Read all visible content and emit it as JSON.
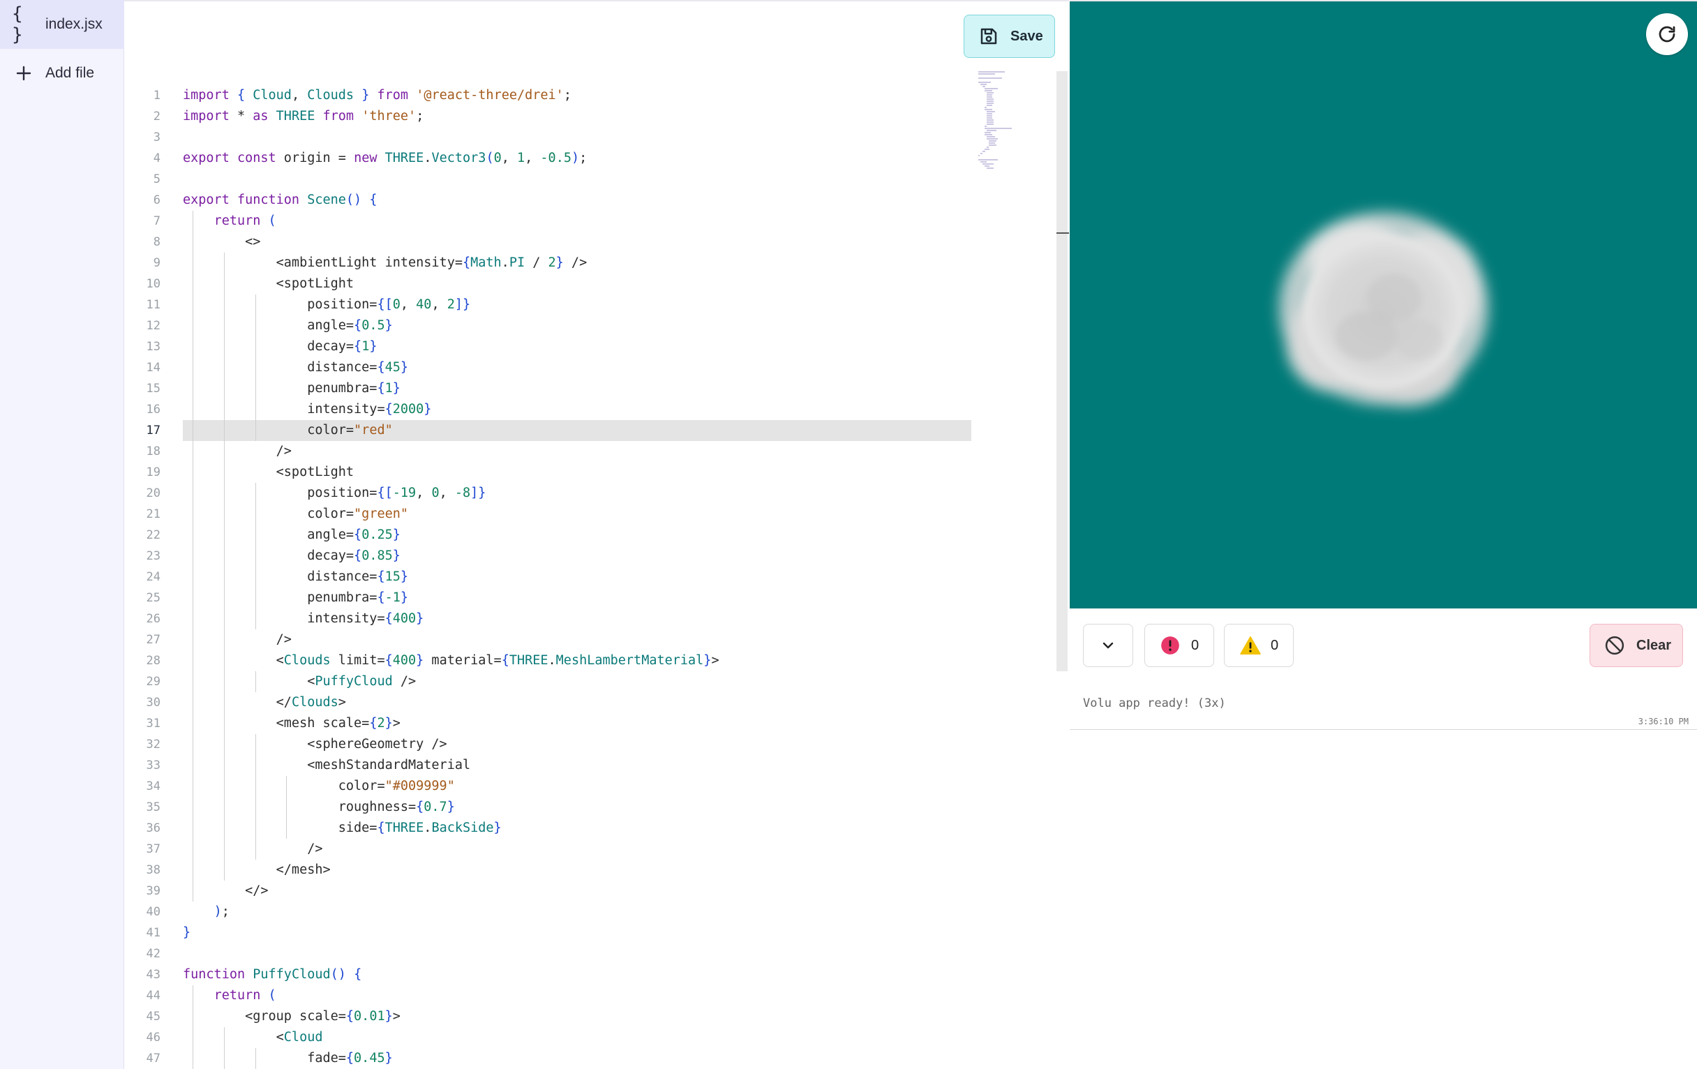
{
  "sidebar": {
    "items": [
      {
        "label": "index.jsx",
        "icon": "braces-icon",
        "glyph": "{ }"
      },
      {
        "label": "Add file",
        "icon": "plus-icon"
      }
    ]
  },
  "toolbar": {
    "save_label": "Save"
  },
  "editor": {
    "current_line": 17,
    "lines": [
      [
        [
          "k",
          "import"
        ],
        [
          "p",
          " "
        ],
        [
          "b",
          "{"
        ],
        [
          "p",
          " "
        ],
        [
          "c",
          "Cloud"
        ],
        [
          "p",
          ", "
        ],
        [
          "c",
          "Clouds"
        ],
        [
          "p",
          " "
        ],
        [
          "b",
          "}"
        ],
        [
          "p",
          " "
        ],
        [
          "k",
          "from"
        ],
        [
          "p",
          " "
        ],
        [
          "s",
          "'@react-three/drei'"
        ],
        [
          "p",
          ";"
        ]
      ],
      [
        [
          "k",
          "import"
        ],
        [
          "p",
          " * "
        ],
        [
          "k",
          "as"
        ],
        [
          "p",
          " "
        ],
        [
          "c",
          "THREE"
        ],
        [
          "p",
          " "
        ],
        [
          "k",
          "from"
        ],
        [
          "p",
          " "
        ],
        [
          "s",
          "'three'"
        ],
        [
          "p",
          ";"
        ]
      ],
      [],
      [
        [
          "k",
          "export"
        ],
        [
          "p",
          " "
        ],
        [
          "k",
          "const"
        ],
        [
          "p",
          " origin = "
        ],
        [
          "k",
          "new"
        ],
        [
          "p",
          " "
        ],
        [
          "c",
          "THREE"
        ],
        [
          "p",
          "."
        ],
        [
          "c",
          "Vector3"
        ],
        [
          "b",
          "("
        ],
        [
          "n",
          "0"
        ],
        [
          "p",
          ", "
        ],
        [
          "n",
          "1"
        ],
        [
          "p",
          ", "
        ],
        [
          "n",
          "-0.5"
        ],
        [
          "b",
          ")"
        ],
        [
          "p",
          ";"
        ]
      ],
      [],
      [
        [
          "k",
          "export"
        ],
        [
          "p",
          " "
        ],
        [
          "k",
          "function"
        ],
        [
          "p",
          " "
        ],
        [
          "c",
          "Scene"
        ],
        [
          "b",
          "()"
        ],
        [
          "p",
          " "
        ],
        [
          "b",
          "{"
        ]
      ],
      [
        [
          "p",
          "    "
        ],
        [
          "k",
          "return"
        ],
        [
          "p",
          " "
        ],
        [
          "b",
          "("
        ]
      ],
      [
        [
          "p",
          "        <>"
        ]
      ],
      [
        [
          "p",
          "            <ambientLight intensity="
        ],
        [
          "b",
          "{"
        ],
        [
          "c",
          "Math"
        ],
        [
          "p",
          "."
        ],
        [
          "c",
          "PI"
        ],
        [
          "p",
          " / "
        ],
        [
          "n",
          "2"
        ],
        [
          "b",
          "}"
        ],
        [
          "p",
          " />"
        ]
      ],
      [
        [
          "p",
          "            <spotLight"
        ]
      ],
      [
        [
          "p",
          "                position="
        ],
        [
          "b",
          "{["
        ],
        [
          "n",
          "0"
        ],
        [
          "p",
          ", "
        ],
        [
          "n",
          "40"
        ],
        [
          "p",
          ", "
        ],
        [
          "n",
          "2"
        ],
        [
          "b",
          "]}"
        ]
      ],
      [
        [
          "p",
          "                angle="
        ],
        [
          "b",
          "{"
        ],
        [
          "n",
          "0.5"
        ],
        [
          "b",
          "}"
        ]
      ],
      [
        [
          "p",
          "                decay="
        ],
        [
          "b",
          "{"
        ],
        [
          "n",
          "1"
        ],
        [
          "b",
          "}"
        ]
      ],
      [
        [
          "p",
          "                distance="
        ],
        [
          "b",
          "{"
        ],
        [
          "n",
          "45"
        ],
        [
          "b",
          "}"
        ]
      ],
      [
        [
          "p",
          "                penumbra="
        ],
        [
          "b",
          "{"
        ],
        [
          "n",
          "1"
        ],
        [
          "b",
          "}"
        ]
      ],
      [
        [
          "p",
          "                intensity="
        ],
        [
          "b",
          "{"
        ],
        [
          "n",
          "2000"
        ],
        [
          "b",
          "}"
        ]
      ],
      [
        [
          "p",
          "                color="
        ],
        [
          "s",
          "\"red\""
        ]
      ],
      [
        [
          "p",
          "            />"
        ]
      ],
      [
        [
          "p",
          "            <spotLight"
        ]
      ],
      [
        [
          "p",
          "                position="
        ],
        [
          "b",
          "{["
        ],
        [
          "n",
          "-19"
        ],
        [
          "p",
          ", "
        ],
        [
          "n",
          "0"
        ],
        [
          "p",
          ", "
        ],
        [
          "n",
          "-8"
        ],
        [
          "b",
          "]}"
        ]
      ],
      [
        [
          "p",
          "                color="
        ],
        [
          "s",
          "\"green\""
        ]
      ],
      [
        [
          "p",
          "                angle="
        ],
        [
          "b",
          "{"
        ],
        [
          "n",
          "0.25"
        ],
        [
          "b",
          "}"
        ]
      ],
      [
        [
          "p",
          "                decay="
        ],
        [
          "b",
          "{"
        ],
        [
          "n",
          "0.85"
        ],
        [
          "b",
          "}"
        ]
      ],
      [
        [
          "p",
          "                distance="
        ],
        [
          "b",
          "{"
        ],
        [
          "n",
          "15"
        ],
        [
          "b",
          "}"
        ]
      ],
      [
        [
          "p",
          "                penumbra="
        ],
        [
          "b",
          "{"
        ],
        [
          "n",
          "-1"
        ],
        [
          "b",
          "}"
        ]
      ],
      [
        [
          "p",
          "                intensity="
        ],
        [
          "b",
          "{"
        ],
        [
          "n",
          "400"
        ],
        [
          "b",
          "}"
        ]
      ],
      [
        [
          "p",
          "            />"
        ]
      ],
      [
        [
          "p",
          "            <"
        ],
        [
          "c",
          "Clouds"
        ],
        [
          "p",
          " limit="
        ],
        [
          "b",
          "{"
        ],
        [
          "n",
          "400"
        ],
        [
          "b",
          "}"
        ],
        [
          "p",
          " material="
        ],
        [
          "b",
          "{"
        ],
        [
          "c",
          "THREE"
        ],
        [
          "p",
          "."
        ],
        [
          "c",
          "MeshLambertMaterial"
        ],
        [
          "b",
          "}"
        ],
        [
          "p",
          ">"
        ]
      ],
      [
        [
          "p",
          "                <"
        ],
        [
          "c",
          "PuffyCloud"
        ],
        [
          "p",
          " />"
        ]
      ],
      [
        [
          "p",
          "            </"
        ],
        [
          "c",
          "Clouds"
        ],
        [
          "p",
          ">"
        ]
      ],
      [
        [
          "p",
          "            <mesh scale="
        ],
        [
          "b",
          "{"
        ],
        [
          "n",
          "2"
        ],
        [
          "b",
          "}"
        ],
        [
          "p",
          ">"
        ]
      ],
      [
        [
          "p",
          "                <sphereGeometry />"
        ]
      ],
      [
        [
          "p",
          "                <meshStandardMaterial"
        ]
      ],
      [
        [
          "p",
          "                    color="
        ],
        [
          "s",
          "\"#009999\""
        ]
      ],
      [
        [
          "p",
          "                    roughness="
        ],
        [
          "b",
          "{"
        ],
        [
          "n",
          "0.7"
        ],
        [
          "b",
          "}"
        ]
      ],
      [
        [
          "p",
          "                    side="
        ],
        [
          "b",
          "{"
        ],
        [
          "c",
          "THREE"
        ],
        [
          "p",
          "."
        ],
        [
          "c",
          "BackSide"
        ],
        [
          "b",
          "}"
        ]
      ],
      [
        [
          "p",
          "                />"
        ]
      ],
      [
        [
          "p",
          "            </mesh>"
        ]
      ],
      [
        [
          "p",
          "        </>"
        ]
      ],
      [
        [
          "p",
          "    "
        ],
        [
          "b",
          ")"
        ],
        [
          "p",
          ";"
        ]
      ],
      [
        [
          "b",
          "}"
        ]
      ],
      [],
      [
        [
          "k",
          "function"
        ],
        [
          "p",
          " "
        ],
        [
          "c",
          "PuffyCloud"
        ],
        [
          "b",
          "()"
        ],
        [
          "p",
          " "
        ],
        [
          "b",
          "{"
        ]
      ],
      [
        [
          "p",
          "    "
        ],
        [
          "k",
          "return"
        ],
        [
          "p",
          " "
        ],
        [
          "b",
          "("
        ]
      ],
      [
        [
          "p",
          "        <group scale="
        ],
        [
          "b",
          "{"
        ],
        [
          "n",
          "0.01"
        ],
        [
          "b",
          "}"
        ],
        [
          "p",
          ">"
        ]
      ],
      [
        [
          "p",
          "            <"
        ],
        [
          "c",
          "Cloud"
        ]
      ],
      [
        [
          "p",
          "                fade="
        ],
        [
          "b",
          "{"
        ],
        [
          "n",
          "0.45"
        ],
        [
          "b",
          "}"
        ]
      ]
    ],
    "guides": [
      [],
      [],
      [],
      [],
      [],
      [],
      [
        1
      ],
      [
        1
      ],
      [
        1,
        2
      ],
      [
        1,
        2
      ],
      [
        1,
        2,
        3
      ],
      [
        1,
        2,
        3
      ],
      [
        1,
        2,
        3
      ],
      [
        1,
        2,
        3
      ],
      [
        1,
        2,
        3
      ],
      [
        1,
        2,
        3
      ],
      [
        1,
        2,
        3
      ],
      [
        1,
        2
      ],
      [
        1,
        2
      ],
      [
        1,
        2,
        3
      ],
      [
        1,
        2,
        3
      ],
      [
        1,
        2,
        3
      ],
      [
        1,
        2,
        3
      ],
      [
        1,
        2,
        3
      ],
      [
        1,
        2,
        3
      ],
      [
        1,
        2,
        3
      ],
      [
        1,
        2
      ],
      [
        1,
        2
      ],
      [
        1,
        2,
        3
      ],
      [
        1,
        2
      ],
      [
        1,
        2
      ],
      [
        1,
        2,
        3
      ],
      [
        1,
        2,
        3
      ],
      [
        1,
        2,
        3,
        4
      ],
      [
        1,
        2,
        3,
        4
      ],
      [
        1,
        2,
        3,
        4
      ],
      [
        1,
        2,
        3
      ],
      [
        1,
        2
      ],
      [
        1
      ],
      [],
      [],
      [],
      [],
      [
        1
      ],
      [
        1
      ],
      [
        1,
        2
      ],
      [
        1,
        2,
        3
      ]
    ]
  },
  "preview": {
    "background": "#007a78"
  },
  "console": {
    "errors": "0",
    "warnings": "0",
    "clear_label": "Clear",
    "message": "Volu app ready! (3x)",
    "timestamp": "3:36:10 PM"
  },
  "colors": {
    "accent": "#0c7a7a",
    "error": "#e8386a",
    "warning": "#f2c200"
  }
}
